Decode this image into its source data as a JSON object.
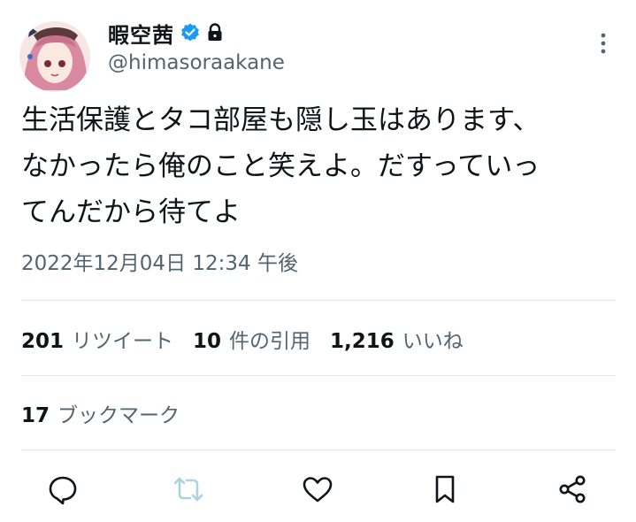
{
  "author": {
    "display_name": "暇空茜",
    "handle": "@himasoraakane",
    "verified_color": "#1d9bf0"
  },
  "tweet": {
    "text_lines": [
      "生活保護とタコ部屋も隠し玉はあります、",
      "なかったら俺のこと笑えよ。だすっていっ",
      "てんだから待てよ"
    ],
    "timestamp": "2022年12月04日 12:34 午後"
  },
  "stats": {
    "retweets_count": "201",
    "retweets_label": "リツイート",
    "quotes_count": "10",
    "quotes_label": "件の引用",
    "likes_count": "1,216",
    "likes_label": "いいね",
    "bookmarks_count": "17",
    "bookmarks_label": "ブックマーク"
  },
  "icons": {
    "verified": "verified-badge-icon",
    "protected": "lock-icon",
    "more": "more-vertical-icon",
    "reply": "reply-icon",
    "retweet": "retweet-icon",
    "like": "heart-icon",
    "bookmark": "bookmark-icon",
    "share": "share-icon"
  },
  "colors": {
    "text": "#0f1419",
    "secondary": "#536471",
    "retweet_disabled": "#a9d3e0"
  }
}
